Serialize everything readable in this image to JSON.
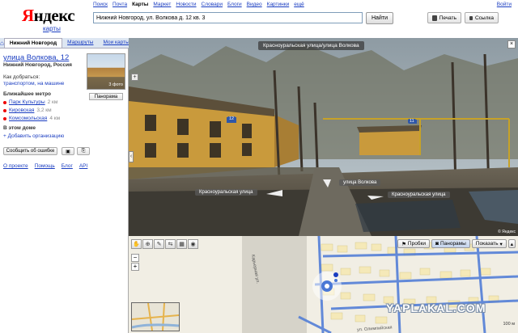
{
  "header": {
    "logo_ya": "Я",
    "logo_rest": "ндекс",
    "logo_sub": "карты",
    "nav": [
      {
        "label": "Поиск",
        "active": false
      },
      {
        "label": "Почта",
        "active": false
      },
      {
        "label": "Карты",
        "active": true
      },
      {
        "label": "Маркет",
        "active": false
      },
      {
        "label": "Новости",
        "active": false
      },
      {
        "label": "Словари",
        "active": false
      },
      {
        "label": "Блоги",
        "active": false
      },
      {
        "label": "Видео",
        "active": false
      },
      {
        "label": "Картинки",
        "active": false
      },
      {
        "label": "ещё",
        "active": false
      }
    ],
    "login": "Войти",
    "search_value": "Нижний Новгород, ул. Волкова д. 12 кв. 3",
    "find_label": "Найти",
    "print_label": "Печать",
    "link_label": "Ссылка"
  },
  "left": {
    "tabs": [
      "Нижний Новгород",
      "Маршруты",
      "Мои карты"
    ],
    "address_title": "улица Волкова, 12",
    "address_sub": "Нижний Новгород, Россия",
    "howto_label": "Как добраться:",
    "howto_links": "транспортом, на машине",
    "photo_count": "3 фото",
    "panorama_button": "Панорама",
    "metro_heading": "Ближайшее метро",
    "metro": [
      {
        "name": "Парк Культуры",
        "dist": "2 км"
      },
      {
        "name": "Кировская",
        "dist": "3,2 км"
      },
      {
        "name": "Комсомольская",
        "dist": "4 км"
      }
    ],
    "building_heading": "В этом доме",
    "add_org": "+ Добавить организацию",
    "report_error": "Сообщить об ошибке",
    "footer_links": [
      "О проекте",
      "Помощь",
      "Блог",
      "API"
    ]
  },
  "panorama": {
    "street_label": "Красноуральская улица/улица Волкова",
    "house_number": "12",
    "house_number_far": "11",
    "label_left": "Красноуральская улица",
    "label_center": "улица Волкова",
    "label_right": "Красноуральская улица",
    "copyright": "© Яндекс"
  },
  "map": {
    "buttons": {
      "probki": "Пробки",
      "panoramy": "Панорамы",
      "pokazat": "Показать"
    },
    "streets": [
      "Карьерная ул.",
      "ул. Олимпийская"
    ],
    "watermark": "YAPLAKAL.COM",
    "scale": "100 м"
  },
  "colors": {
    "accent_link": "#1a3dc1",
    "metro_red": "#e00000",
    "logo_red": "#ff0000",
    "map_road_blue": "#4a78d6"
  }
}
